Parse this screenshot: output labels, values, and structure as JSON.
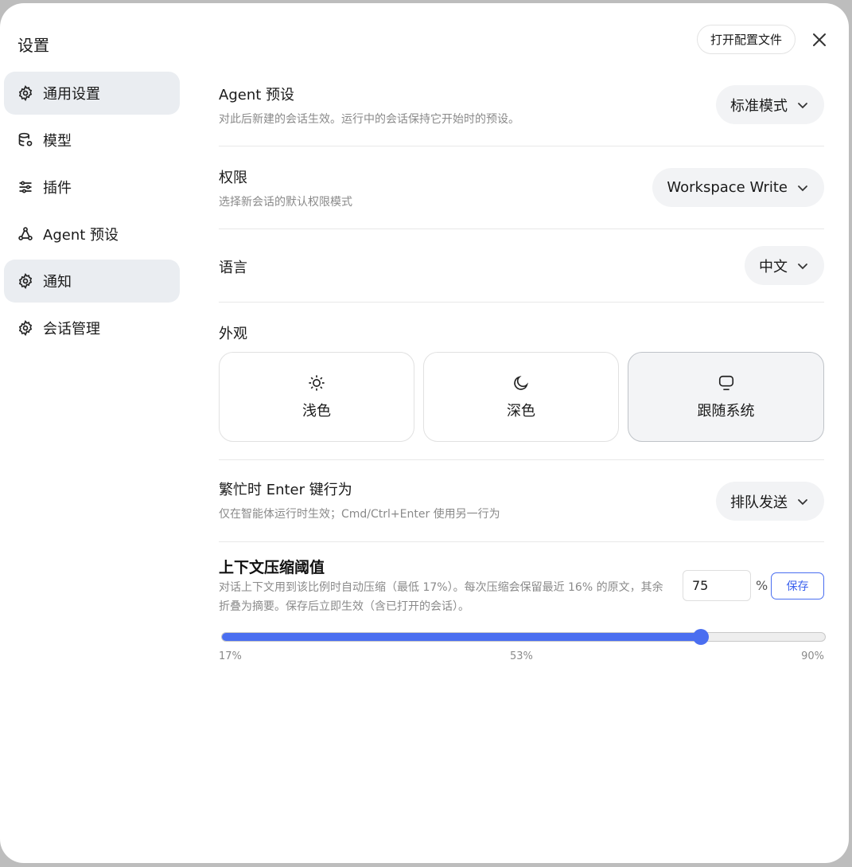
{
  "dialog": {
    "title": "设置",
    "open_config_label": "打开配置文件",
    "close_icon": "close-icon"
  },
  "sidebar": {
    "items": [
      {
        "label": "通用设置",
        "icon": "gear-icon",
        "active": true
      },
      {
        "label": "模型",
        "icon": "database-gear-icon",
        "active": false
      },
      {
        "label": "插件",
        "icon": "sliders-icon",
        "active": false
      },
      {
        "label": "Agent 预设",
        "icon": "nodes-icon",
        "active": false
      },
      {
        "label": "通知",
        "icon": "gear-icon",
        "active": true
      },
      {
        "label": "会话管理",
        "icon": "gear-icon",
        "active": false
      }
    ]
  },
  "settings": {
    "agent_preset": {
      "title": "Agent 预设",
      "desc": "对此后新建的会话生效。运行中的会话保持它开始时的预设。",
      "value": "标准模式"
    },
    "permission": {
      "title": "权限",
      "desc": "选择新会话的默认权限模式",
      "value": "Workspace Write"
    },
    "language": {
      "title": "语言",
      "value": "中文"
    },
    "appearance": {
      "title": "外观",
      "options": [
        {
          "label": "浅色",
          "icon": "sun-icon"
        },
        {
          "label": "深色",
          "icon": "moon-icon"
        },
        {
          "label": "跟随系统",
          "icon": "monitor-icon"
        }
      ],
      "selected": "跟随系统"
    },
    "busy_enter": {
      "title": "繁忙时 Enter 键行为",
      "desc": "仅在智能体运行时生效；Cmd/Ctrl+Enter 使用另一行为",
      "value": "排队发送"
    },
    "context_compress": {
      "title": "上下文压缩阈值",
      "desc": "对话上下文用到该比例时自动压缩（最低 17%）。每次压缩会保留最近 16% 的原文，其余折叠为摘要。保存后立即生效（含已打开的会话）。",
      "input_value": "75",
      "unit": "%",
      "save_label": "保存",
      "slider_min": 17,
      "slider_max": 90,
      "slider_value": 75,
      "tick_labels": [
        "17%",
        "53%",
        "90%"
      ]
    }
  },
  "colors": {
    "accent": "#4a6ef0",
    "active_bg": "#eaedf1",
    "muted_text": "#8a8a8a"
  }
}
